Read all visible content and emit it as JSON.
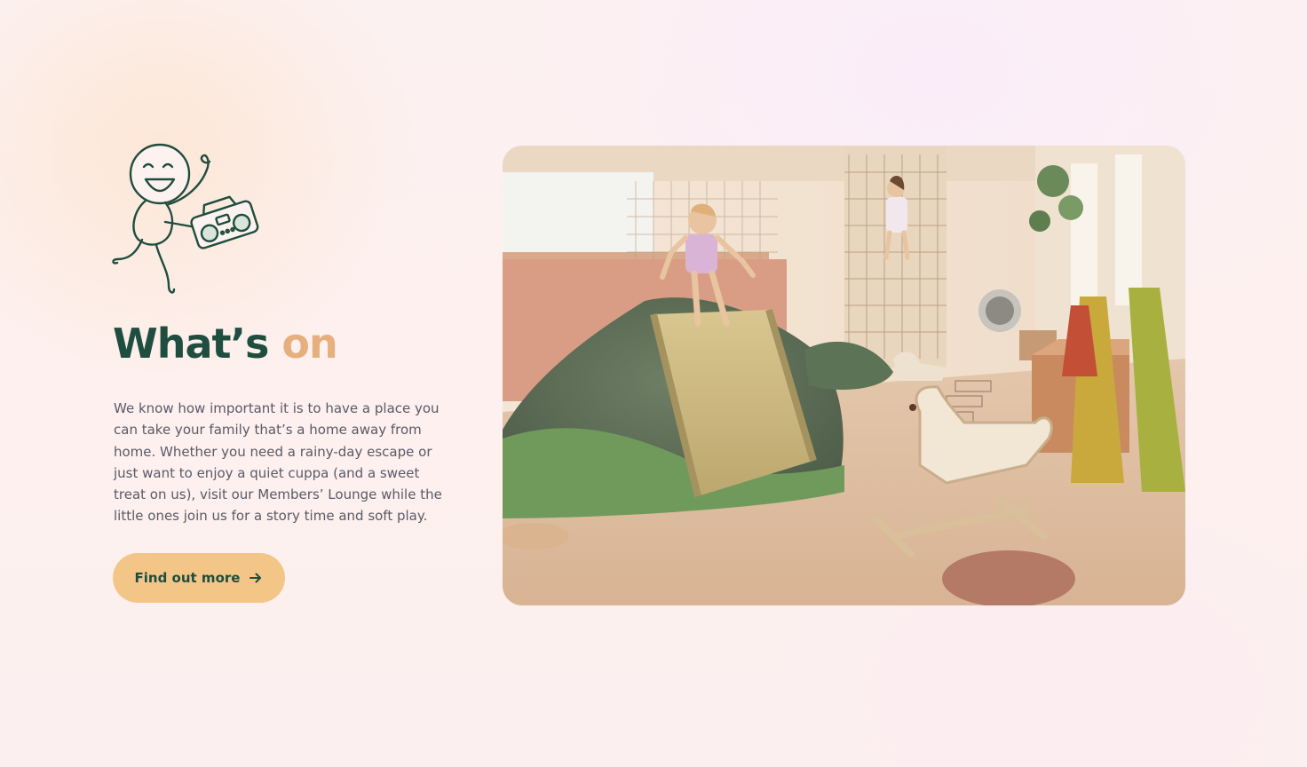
{
  "section": {
    "title_main": "What’s",
    "title_accent": "on",
    "description": "We know how important it is to have a place you can take your family that’s a home away from home. Whether you need a rainy-day escape or just want to enjoy a quiet cuppa (and a sweet treat on us), visit our Members’ Lounge while the little ones join us for a story time and soft play.",
    "cta_label": "Find out more",
    "cta_icon": "arrow-right-icon",
    "mascot_icon": "dancing-mascot-with-boombox-icon",
    "photo": "soft-play-room-photo"
  },
  "colors": {
    "heading": "#1f4d3f",
    "heading_accent": "#e6b07e",
    "body_text": "#5a5a67",
    "button_bg": "#f3c687",
    "button_text": "#1f4d3f",
    "mascot_stroke": "#1f4d3f"
  }
}
